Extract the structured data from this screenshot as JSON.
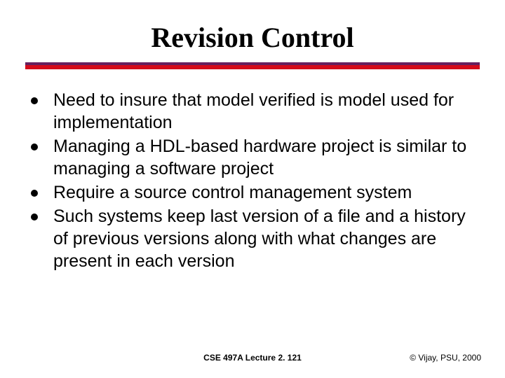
{
  "title": "Revision Control",
  "bullets": [
    "Need to insure that model verified is model used for implementation",
    "Managing a HDL-based hardware project is similar to managing a software project",
    "Require a source control management system",
    "Such systems keep last version of a file and a history of previous versions along with what changes are present in each version"
  ],
  "footer": {
    "center": "CSE 497A Lecture 2. 121",
    "right": "© Vijay, PSU, 2000"
  }
}
